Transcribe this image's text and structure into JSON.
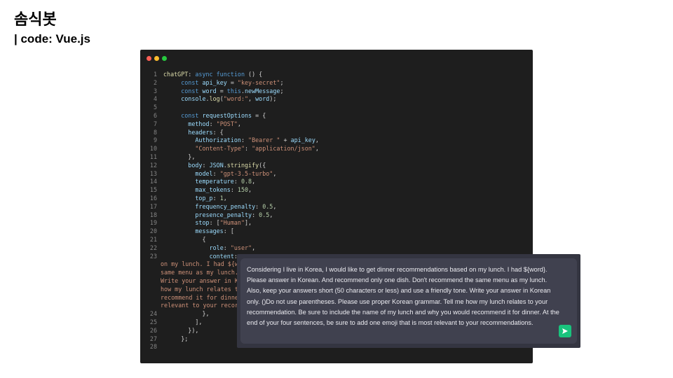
{
  "slide": {
    "title": "솜식봇",
    "subtitle": "| code: Vue.js"
  },
  "window": {
    "dot_colors": [
      "#ff5f56",
      "#ffbd2e",
      "#27c93f"
    ]
  },
  "code_lines": [
    {
      "n": "1",
      "t": [
        [
          "f",
          "chatGPT"
        ],
        [
          "w",
          ": "
        ],
        [
          "k",
          "async function"
        ],
        [
          "w",
          " () {"
        ]
      ]
    },
    {
      "n": "2",
      "t": [
        [
          "w",
          "     "
        ],
        [
          "k",
          "const"
        ],
        [
          "w",
          " "
        ],
        [
          "p",
          "api_key"
        ],
        [
          "w",
          " = "
        ],
        [
          "s",
          "\"key-secret\""
        ],
        [
          "w",
          ";"
        ]
      ]
    },
    {
      "n": "3",
      "t": [
        [
          "w",
          "     "
        ],
        [
          "k",
          "const"
        ],
        [
          "w",
          " "
        ],
        [
          "p",
          "word"
        ],
        [
          "w",
          " = "
        ],
        [
          "k",
          "this"
        ],
        [
          "w",
          "."
        ],
        [
          "p",
          "newMessage"
        ],
        [
          "w",
          ";"
        ]
      ]
    },
    {
      "n": "4",
      "t": [
        [
          "w",
          "     "
        ],
        [
          "p",
          "console"
        ],
        [
          "w",
          "."
        ],
        [
          "f",
          "log"
        ],
        [
          "w",
          "("
        ],
        [
          "s",
          "\"word:\""
        ],
        [
          "w",
          ", "
        ],
        [
          "p",
          "word"
        ],
        [
          "w",
          ");"
        ]
      ]
    },
    {
      "n": "5",
      "t": []
    },
    {
      "n": "6",
      "t": [
        [
          "w",
          "     "
        ],
        [
          "k",
          "const"
        ],
        [
          "w",
          " "
        ],
        [
          "p",
          "requestOptions"
        ],
        [
          "w",
          " = {"
        ]
      ]
    },
    {
      "n": "7",
      "t": [
        [
          "w",
          "       "
        ],
        [
          "p",
          "method"
        ],
        [
          "w",
          ": "
        ],
        [
          "s",
          "\"POST\""
        ],
        [
          "w",
          ","
        ]
      ]
    },
    {
      "n": "8",
      "t": [
        [
          "w",
          "       "
        ],
        [
          "p",
          "headers"
        ],
        [
          "w",
          ": {"
        ]
      ]
    },
    {
      "n": "9",
      "t": [
        [
          "w",
          "         "
        ],
        [
          "p",
          "Authorization"
        ],
        [
          "w",
          ": "
        ],
        [
          "s",
          "\"Bearer \""
        ],
        [
          "w",
          " + "
        ],
        [
          "p",
          "api_key"
        ],
        [
          "w",
          ","
        ]
      ]
    },
    {
      "n": "10",
      "t": [
        [
          "w",
          "         "
        ],
        [
          "s",
          "\"Content-Type\""
        ],
        [
          "w",
          ": "
        ],
        [
          "s",
          "\"application/json\""
        ],
        [
          "w",
          ","
        ]
      ]
    },
    {
      "n": "11",
      "t": [
        [
          "w",
          "       },"
        ]
      ]
    },
    {
      "n": "12",
      "t": [
        [
          "w",
          "       "
        ],
        [
          "p",
          "body"
        ],
        [
          "w",
          ": "
        ],
        [
          "p",
          "JSON"
        ],
        [
          "w",
          "."
        ],
        [
          "f",
          "stringify"
        ],
        [
          "w",
          "({"
        ]
      ]
    },
    {
      "n": "13",
      "t": [
        [
          "w",
          "         "
        ],
        [
          "p",
          "model"
        ],
        [
          "w",
          ": "
        ],
        [
          "s",
          "\"gpt-3.5-turbo\""
        ],
        [
          "w",
          ","
        ]
      ]
    },
    {
      "n": "14",
      "t": [
        [
          "w",
          "         "
        ],
        [
          "p",
          "temperature"
        ],
        [
          "w",
          ": "
        ],
        [
          "n",
          "0.8"
        ],
        [
          "w",
          ","
        ]
      ]
    },
    {
      "n": "15",
      "t": [
        [
          "w",
          "         "
        ],
        [
          "p",
          "max_tokens"
        ],
        [
          "w",
          ": "
        ],
        [
          "n",
          "150"
        ],
        [
          "w",
          ","
        ]
      ]
    },
    {
      "n": "16",
      "t": [
        [
          "w",
          "         "
        ],
        [
          "p",
          "top_p"
        ],
        [
          "w",
          ": "
        ],
        [
          "n",
          "1"
        ],
        [
          "w",
          ","
        ]
      ]
    },
    {
      "n": "17",
      "t": [
        [
          "w",
          "         "
        ],
        [
          "p",
          "frequency_penalty"
        ],
        [
          "w",
          ": "
        ],
        [
          "n",
          "0.5"
        ],
        [
          "w",
          ","
        ]
      ]
    },
    {
      "n": "18",
      "t": [
        [
          "w",
          "         "
        ],
        [
          "p",
          "presence_penalty"
        ],
        [
          "w",
          ": "
        ],
        [
          "n",
          "0.5"
        ],
        [
          "w",
          ","
        ]
      ]
    },
    {
      "n": "19",
      "t": [
        [
          "w",
          "         "
        ],
        [
          "p",
          "stop"
        ],
        [
          "w",
          ": ["
        ],
        [
          "s",
          "\"Human\""
        ],
        [
          "w",
          "],"
        ]
      ]
    },
    {
      "n": "20",
      "t": [
        [
          "w",
          "         "
        ],
        [
          "p",
          "messages"
        ],
        [
          "w",
          ": ["
        ]
      ]
    },
    {
      "n": "21",
      "t": [
        [
          "w",
          "           {"
        ]
      ]
    },
    {
      "n": "22",
      "t": [
        [
          "w",
          "             "
        ],
        [
          "p",
          "role"
        ],
        [
          "w",
          ": "
        ],
        [
          "s",
          "\"user\""
        ],
        [
          "w",
          ","
        ]
      ]
    },
    {
      "n": "23",
      "t": [
        [
          "w",
          "             "
        ],
        [
          "p",
          "content"
        ],
        [
          "w",
          ":"
        ]
      ]
    },
    {
      "n": "",
      "wrap": "on my lunch. I had ${w"
    },
    {
      "n": "",
      "wrap": "same menu as my lunch."
    },
    {
      "n": "",
      "wrap": "Write your answer in K"
    },
    {
      "n": "",
      "wrap": "how my lunch relates t"
    },
    {
      "n": "",
      "wrap": "recommend it for dinne"
    },
    {
      "n": "",
      "wrap": "relevant to your recor"
    },
    {
      "n": "24",
      "t": [
        [
          "w",
          "           },"
        ]
      ]
    },
    {
      "n": "25",
      "t": [
        [
          "w",
          "         ],"
        ]
      ]
    },
    {
      "n": "26",
      "t": [
        [
          "w",
          "       }),"
        ]
      ]
    },
    {
      "n": "27",
      "t": [
        [
          "w",
          "     };"
        ]
      ]
    },
    {
      "n": "28",
      "t": []
    }
  ],
  "chat_input": {
    "text": "Considering I live in Korea, I would like to get dinner recommendations based on my lunch. I had ${word}. Please answer in Korean. And recommend only one dish. Don't recommend the same menu as my lunch. Also, keep your answers short (50 characters or less) and use a friendly tone. Write your answer in Korean only. ()Do not use parentheses. Please use proper Korean grammar. Tell me how my lunch relates to your recommendation. Be sure to include the name of my lunch and why you would recommend it for dinner. At the end of your four sentences, be sure to add one emoji that is most relevant to your recommendations.",
    "send_icon": "send-icon",
    "send_color": "#19c37d"
  }
}
